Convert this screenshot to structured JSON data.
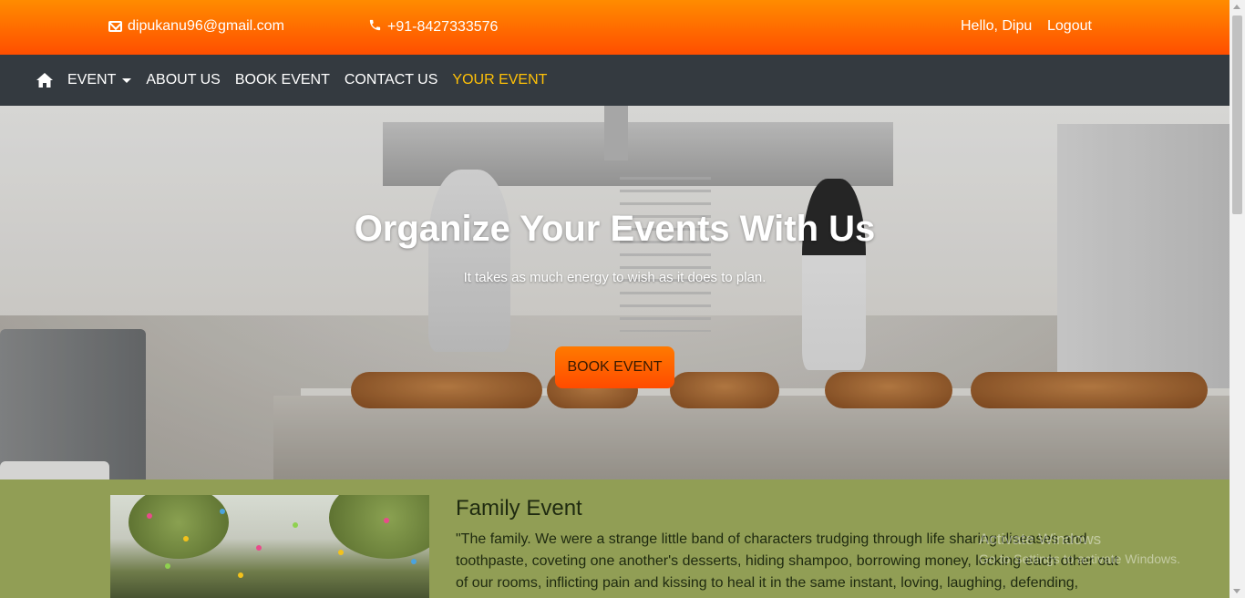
{
  "topbar": {
    "email": "dipukanu96@gmail.com",
    "phone": "+91-8427333576",
    "greeting": "Hello, Dipu",
    "logout": "Logout"
  },
  "nav": {
    "items": [
      {
        "label": "EVENT",
        "has_dropdown": true
      },
      {
        "label": "ABOUT US"
      },
      {
        "label": "BOOK EVENT"
      },
      {
        "label": "CONTACT US"
      },
      {
        "label": "YOUR EVENT",
        "active": true
      }
    ]
  },
  "hero": {
    "title": "Organize Your Events With Us",
    "subtitle": "It takes as much energy to wish as it does to plan.",
    "cta": "BOOK EVENT"
  },
  "family": {
    "title": "Family Event",
    "text": "\"The family. We were a strange little band of characters trudging through life sharing diseases and toothpaste, coveting one another's desserts, hiding shampoo, borrowing money, locking each other out of our rooms, inflicting pain and kissing to heal it in the same instant, loving, laughing, defending,"
  },
  "watermark": {
    "line1": "Activate Windows",
    "line2": "Go to Settings to activate Windows."
  },
  "colors": {
    "topbar_orange": "#ff6a00",
    "navbar": "#343a40",
    "active_nav": "#ffc107",
    "section_green": "#919e55"
  }
}
